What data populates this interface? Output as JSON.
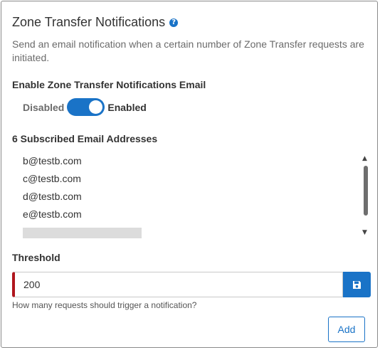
{
  "panel": {
    "title": "Zone Transfer Notifications",
    "help_icon": "?",
    "description": "Send an email notification when a certain number of Zone Transfer requests are initiated."
  },
  "notifications_email": {
    "label": "Enable Zone Transfer Notifications Email",
    "off_label": "Disabled",
    "on_label": "Enabled",
    "enabled": true
  },
  "subscribed": {
    "label": "6 Subscribed Email Addresses",
    "emails": [
      "b@testb.com",
      "c@testb.com",
      "d@testb.com",
      "e@testb.com"
    ]
  },
  "threshold": {
    "label": "Threshold",
    "value": "200",
    "hint": "How many requests should trigger a notification?"
  },
  "actions": {
    "add_label": "Add"
  },
  "icons": {
    "help": "question-circle-icon",
    "save": "save-icon",
    "scroll_up": "triangle-up-icon",
    "scroll_down": "triangle-down-icon"
  },
  "colors": {
    "accent": "#1a73c7",
    "error_border": "#b0161e"
  }
}
